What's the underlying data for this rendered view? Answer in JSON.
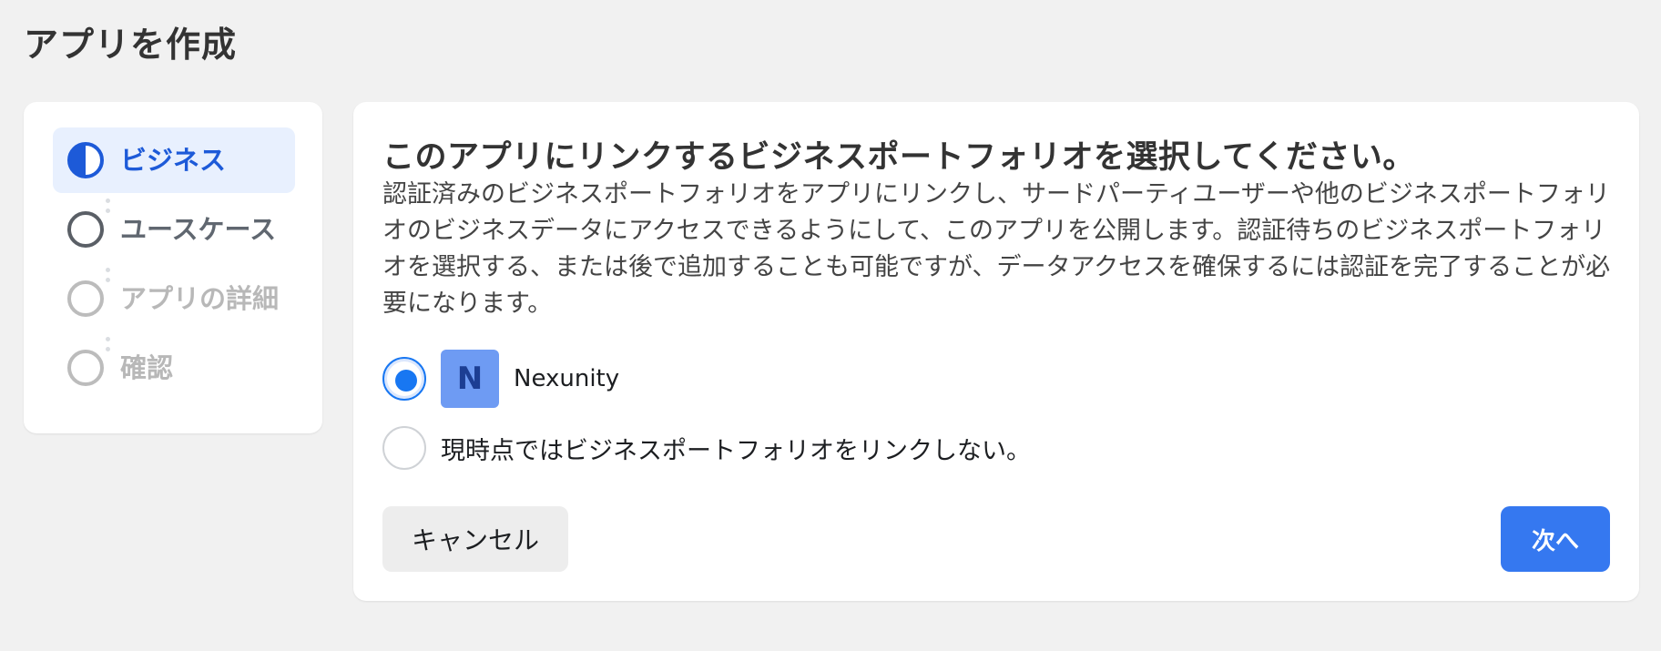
{
  "page": {
    "title": "アプリを作成"
  },
  "stepper": {
    "steps": [
      {
        "label": "ビジネス",
        "state": "active"
      },
      {
        "label": "ユースケース",
        "state": "done"
      },
      {
        "label": "アプリの詳細",
        "state": "todo"
      },
      {
        "label": "確認",
        "state": "todo"
      }
    ]
  },
  "main": {
    "heading": "このアプリにリンクするビジネスポートフォリオを選択してください。",
    "description": "認証済みのビジネスポートフォリオをアプリにリンクし、サードパーティユーザーや他のビジネスポートフォリオのビジネスデータにアクセスできるようにして、このアプリを公開します。認証待ちのビジネスポートフォリオを選択する、または後で追加することも可能ですが、データアクセスを確保するには認証を完了することが必要になります。",
    "options": [
      {
        "avatar_letter": "N",
        "label": "Nexunity",
        "checked": true
      },
      {
        "label": "現時点ではビジネスポートフォリオをリンクしない。",
        "checked": false
      }
    ],
    "cancel_label": "キャンセル",
    "next_label": "次へ"
  },
  "colors": {
    "accent": "#1877f2",
    "primary_button": "#3578f0",
    "avatar_bg": "#6e9bf3"
  }
}
